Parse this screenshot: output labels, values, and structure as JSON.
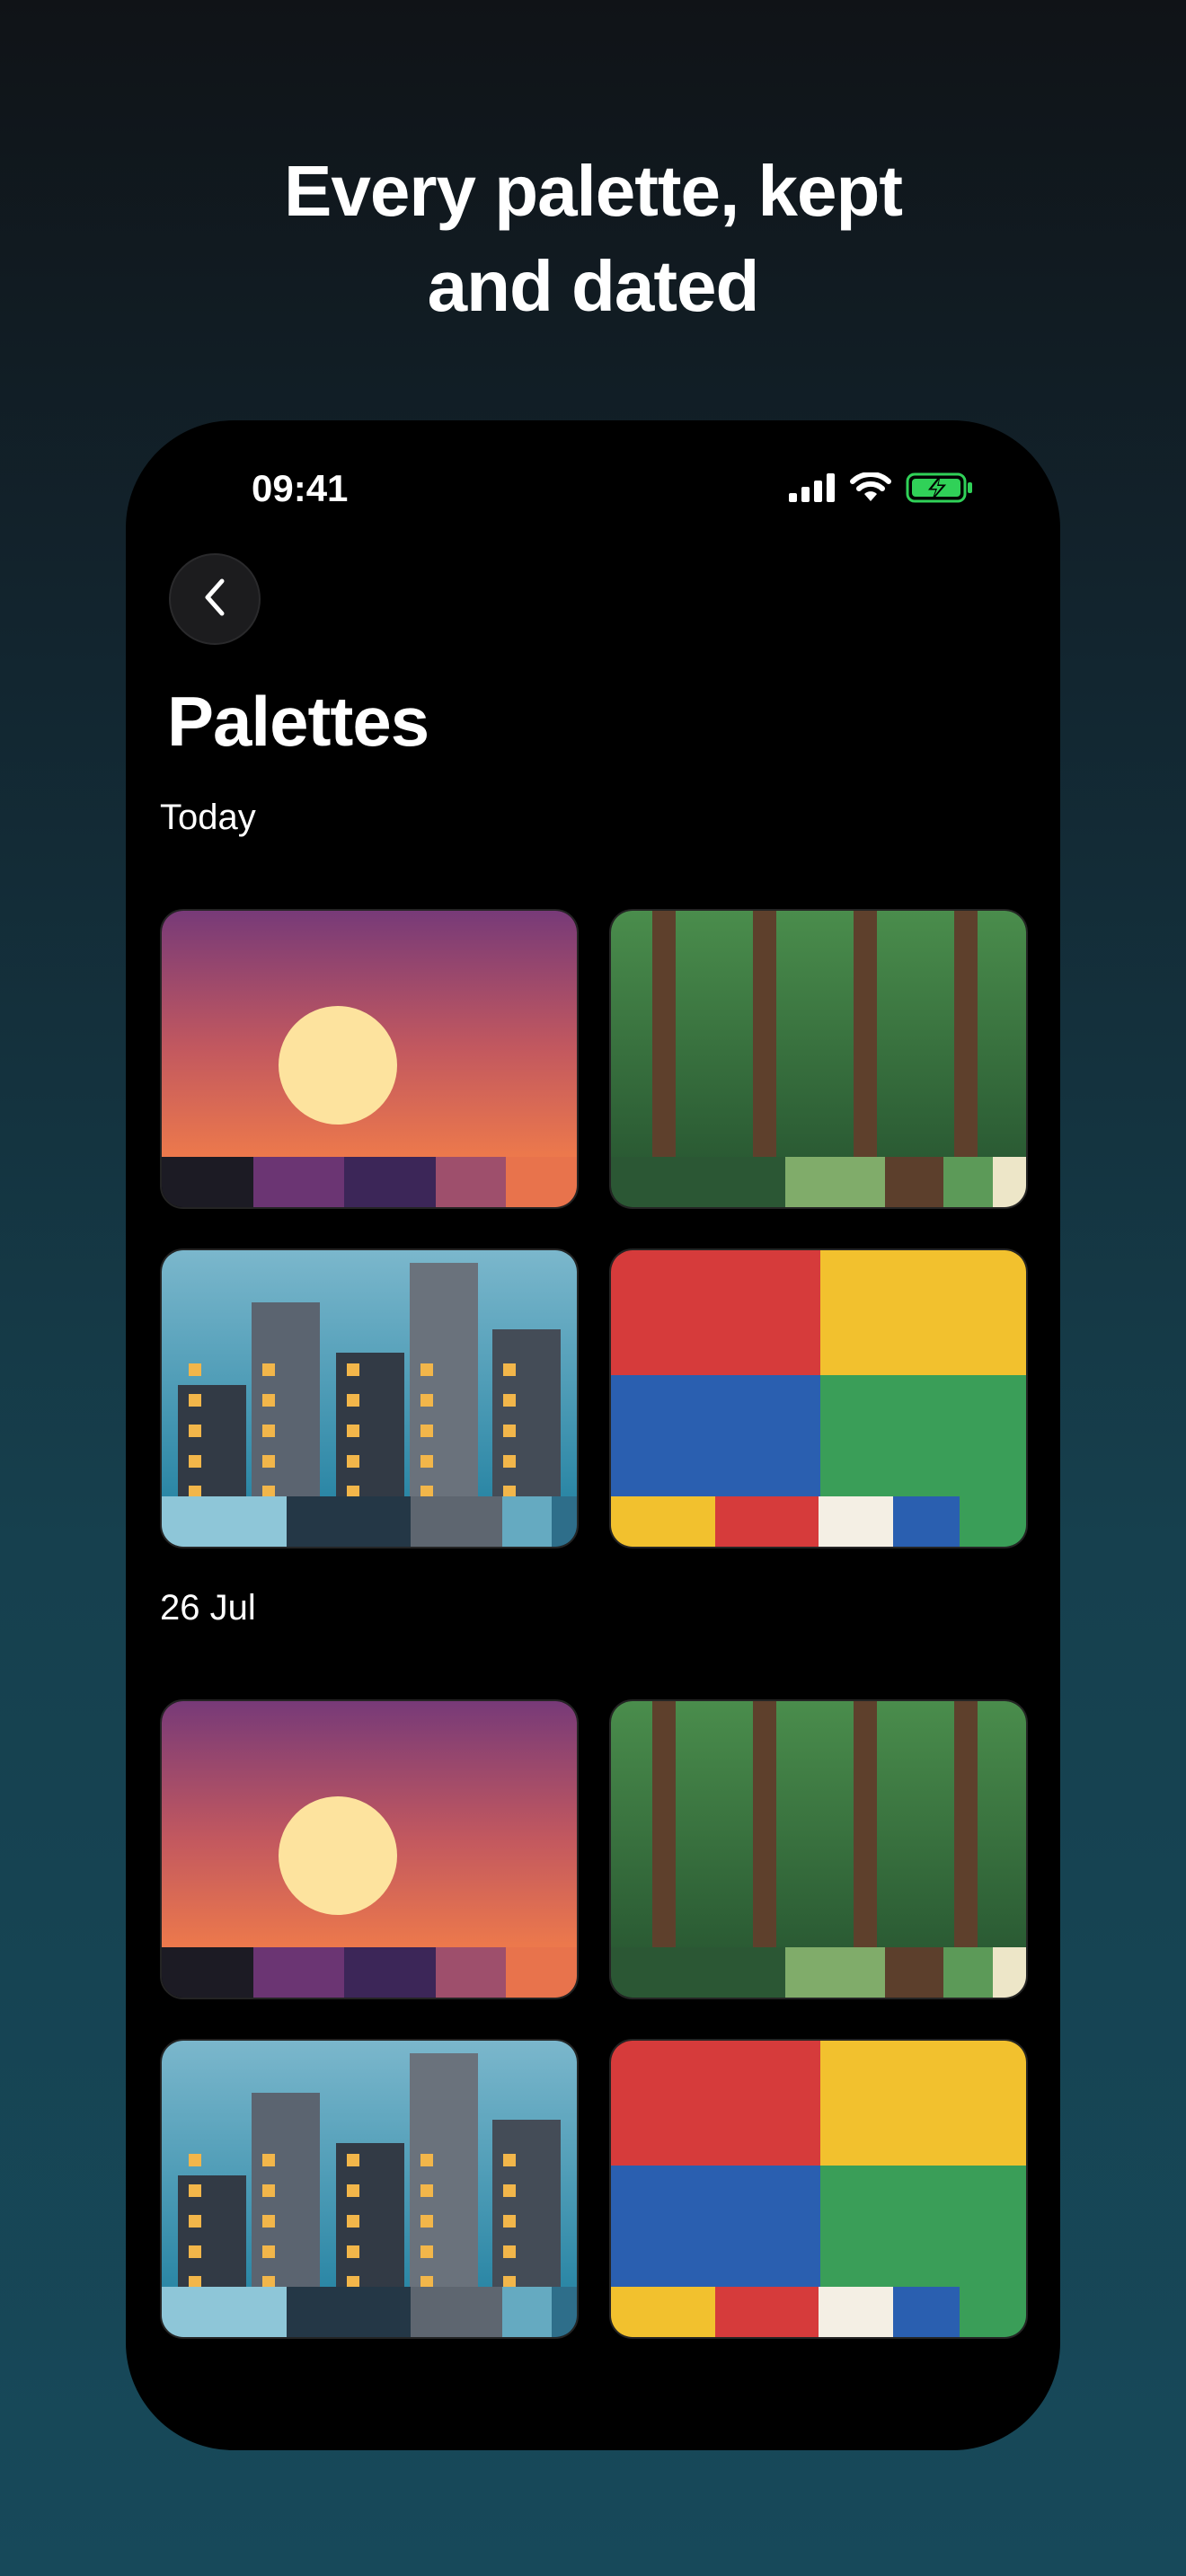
{
  "headline": {
    "line1": "Every palette, kept",
    "line2": "and dated"
  },
  "status_bar": {
    "time": "09:41",
    "battery_color": "#30d158"
  },
  "page": {
    "title": "Palettes"
  },
  "sections": [
    {
      "label": "Today",
      "cards": [
        {
          "art": "sunset",
          "swatches": [
            "#1c1b24",
            "#6b3573",
            "#3c2658",
            "#9e4f6c",
            "#e8734c"
          ]
        },
        {
          "art": "forest",
          "swatches": [
            "#2b5734",
            "#2b5734",
            "#80ac6a",
            "#5c3f2c",
            "#5c9a58",
            "#ede6c8"
          ]
        },
        {
          "art": "city",
          "swatches": [
            "#8ec6d8",
            "#243746",
            "#5e6670",
            "#65aac1",
            "#2e6e8a"
          ]
        },
        {
          "art": "blocks",
          "swatches": [
            "#f2c12e",
            "#d63b3b",
            "#f4efe4",
            "#2a5fb0",
            "#3a9e58"
          ]
        }
      ]
    },
    {
      "label": "26 Jul",
      "cards": [
        {
          "art": "sunset",
          "swatches": [
            "#1c1b24",
            "#6b3573",
            "#3c2658",
            "#9e4f6c",
            "#e8734c"
          ]
        },
        {
          "art": "forest",
          "swatches": [
            "#2b5734",
            "#2b5734",
            "#80ac6a",
            "#5c3f2c",
            "#5c9a58",
            "#ede6c8"
          ]
        },
        {
          "art": "city",
          "swatches": [
            "#8ec6d8",
            "#243746",
            "#5e6670",
            "#65aac1",
            "#2e6e8a"
          ]
        },
        {
          "art": "blocks",
          "swatches": [
            "#f2c12e",
            "#d63b3b",
            "#f4efe4",
            "#2a5fb0",
            "#3a9e58"
          ]
        }
      ]
    }
  ]
}
